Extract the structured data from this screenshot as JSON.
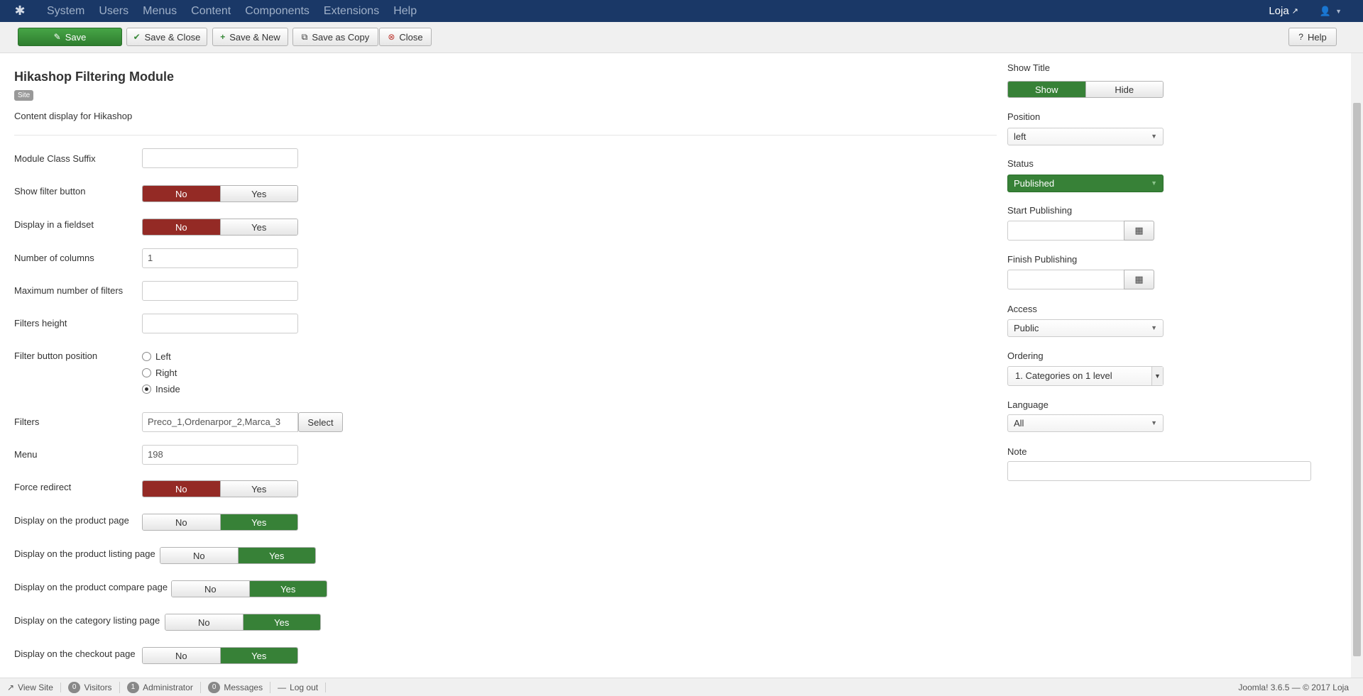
{
  "topnav": {
    "menu": [
      "System",
      "Users",
      "Menus",
      "Content",
      "Components",
      "Extensions",
      "Help"
    ],
    "site_name": "Loja"
  },
  "toolbar": {
    "save": "Save",
    "save_close": "Save & Close",
    "save_new": "Save & New",
    "save_copy": "Save as Copy",
    "close": "Close",
    "help": "Help"
  },
  "module": {
    "title": "Hikashop Filtering Module",
    "badge": "Site",
    "description": "Content display for Hikashop"
  },
  "form": {
    "module_class_suffix": {
      "label": "Module Class Suffix",
      "value": ""
    },
    "show_filter_button": {
      "label": "Show filter button",
      "no": "No",
      "yes": "Yes"
    },
    "display_fieldset": {
      "label": "Display in a fieldset",
      "no": "No",
      "yes": "Yes"
    },
    "number_columns": {
      "label": "Number of columns",
      "value": "1"
    },
    "max_filters": {
      "label": "Maximum number of filters",
      "value": ""
    },
    "filters_height": {
      "label": "Filters height",
      "value": ""
    },
    "filter_button_position": {
      "label": "Filter button position",
      "options": [
        "Left",
        "Right",
        "Inside"
      ],
      "selected": "Inside"
    },
    "filters": {
      "label": "Filters",
      "value": "Preco_1,Ordenarpor_2,Marca_3",
      "select_label": "Select"
    },
    "menu": {
      "label": "Menu",
      "value": "198"
    },
    "force_redirect": {
      "label": "Force redirect",
      "no": "No",
      "yes": "Yes"
    },
    "product_page": {
      "label": "Display on the product page",
      "no": "No",
      "yes": "Yes"
    },
    "product_listing": {
      "label": "Display on the product listing page",
      "no": "No",
      "yes": "Yes"
    },
    "product_compare": {
      "label": "Display on the product compare page",
      "no": "No",
      "yes": "Yes"
    },
    "category_listing": {
      "label": "Display on the category listing page",
      "no": "No",
      "yes": "Yes"
    },
    "checkout_page": {
      "label": "Display on the checkout page",
      "no": "No",
      "yes": "Yes"
    }
  },
  "sidebar": {
    "show_title": {
      "label": "Show Title",
      "show": "Show",
      "hide": "Hide"
    },
    "position": {
      "label": "Position",
      "value": "left"
    },
    "status": {
      "label": "Status",
      "value": "Published"
    },
    "start_publishing": {
      "label": "Start Publishing",
      "value": ""
    },
    "finish_publishing": {
      "label": "Finish Publishing",
      "value": ""
    },
    "access": {
      "label": "Access",
      "value": "Public"
    },
    "ordering": {
      "label": "Ordering",
      "value": "1. Categories on 1 level"
    },
    "language": {
      "label": "Language",
      "value": "All"
    },
    "note": {
      "label": "Note",
      "value": ""
    }
  },
  "statusbar": {
    "view_site": "View Site",
    "visitors_count": "0",
    "visitors": "Visitors",
    "admin_count": "1",
    "administrator": "Administrator",
    "messages_count": "0",
    "messages": "Messages",
    "logout": "Log out",
    "version": "Joomla! 3.6.5 — © 2017 Loja"
  },
  "colors": {
    "nav_bg": "#1a3867",
    "success": "#378137",
    "danger": "#942a25"
  }
}
